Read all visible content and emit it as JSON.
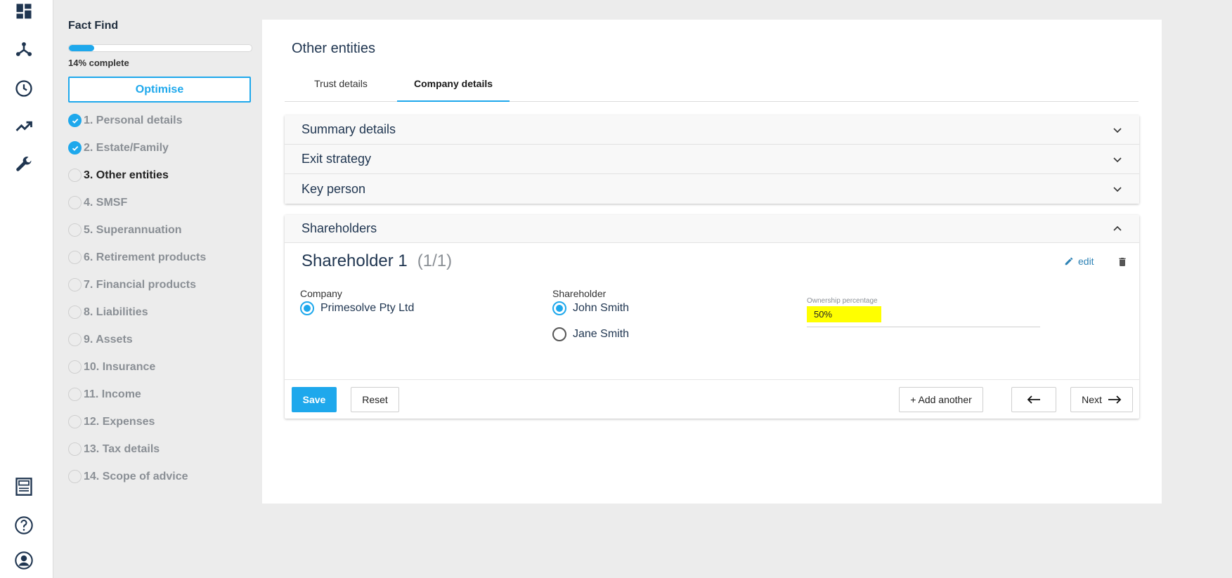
{
  "rail": {
    "icons": [
      "dashboard-icon",
      "network-icon",
      "clock-icon",
      "trending-icon",
      "wrench-icon",
      "document-icon",
      "help-icon",
      "user-icon"
    ]
  },
  "sidebar": {
    "title": "Fact Find",
    "progress_fraction": 0.14,
    "progress_label": "14% complete",
    "optimise_label": "Optimise",
    "steps": [
      {
        "label": "1. Personal details",
        "done": true
      },
      {
        "label": "2. Estate/Family",
        "done": true
      },
      {
        "label": "3. Other entities",
        "active": true
      },
      {
        "label": "4. SMSF"
      },
      {
        "label": "5. Superannuation"
      },
      {
        "label": "6. Retirement products"
      },
      {
        "label": "7. Financial products"
      },
      {
        "label": "8. Liabilities"
      },
      {
        "label": "9. Assets"
      },
      {
        "label": "10. Insurance"
      },
      {
        "label": "11. Income"
      },
      {
        "label": "12. Expenses"
      },
      {
        "label": "13. Tax details"
      },
      {
        "label": "14. Scope of advice"
      }
    ]
  },
  "main": {
    "title": "Other entities",
    "tabs": [
      {
        "label": "Trust details"
      },
      {
        "label": "Company details",
        "active": true
      }
    ],
    "accordions": [
      {
        "label": "Summary details"
      },
      {
        "label": "Exit strategy"
      },
      {
        "label": "Key person"
      }
    ],
    "shareholders": {
      "header": "Shareholders",
      "title": "Shareholder 1",
      "count": "(1/1)",
      "edit_label": "edit",
      "company_label": "Company",
      "company_options": [
        "Primesolve Pty Ltd"
      ],
      "shareholder_label": "Shareholder",
      "shareholder_options": [
        "John Smith",
        "Jane Smith"
      ],
      "ownership_label": "Ownership percentage",
      "ownership_value": "50%"
    },
    "footer": {
      "save": "Save",
      "reset": "Reset",
      "add": "+ Add another",
      "next": "Next"
    }
  },
  "colors": {
    "accent": "#1ea8ec",
    "highlight": "#ffff00",
    "navy": "#1f3550"
  }
}
